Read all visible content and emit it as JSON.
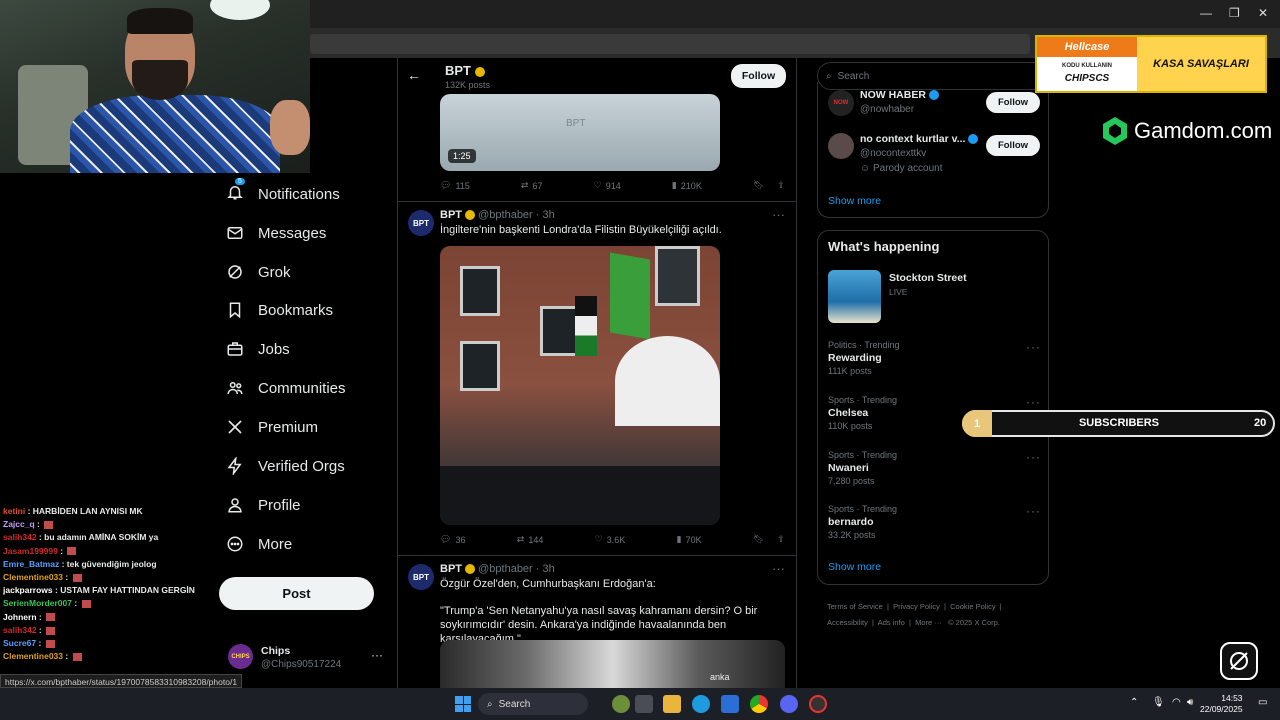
{
  "profile_header": {
    "name": "BPT",
    "posts": "132K posts",
    "follow_label": "Follow"
  },
  "tweets": [
    {
      "video_duration": "1:25",
      "video_watermark": "BPT",
      "replies": "115",
      "retweets": "67",
      "likes": "914",
      "views": "210K"
    },
    {
      "name": "BPT",
      "handle": "@bpthaber",
      "time": "· 3h",
      "text": "İngiltere'nin başkenti Londra'da Filistin Büyükelçiliği açıldı.",
      "replies": "36",
      "retweets": "144",
      "likes": "3.6K",
      "views": "70K"
    },
    {
      "name": "BPT",
      "handle": "@bpthaber",
      "time": "· 3h",
      "text_line1": "Özgür Özel'den, Cumhurbaşkanı Erdoğan'a:",
      "text_line2": "\"Trump'a 'Sen Netanyahu'ya nasıl savaş kahramanı dersin? O bir soykırımcıdır' desin. Ankara'ya indiğinde havaalanında ben karşılayacağım.\"",
      "media_tag": "anka"
    }
  ],
  "nav": {
    "notifications": "Notifications",
    "notifications_badge": "5",
    "messages": "Messages",
    "grok": "Grok",
    "bookmarks": "Bookmarks",
    "jobs": "Jobs",
    "communities": "Communities",
    "premium": "Premium",
    "verified_orgs": "Verified Orgs",
    "profile": "Profile",
    "more": "More",
    "post": "Post"
  },
  "account": {
    "name": "Chips",
    "handle": "@Chips90517224",
    "avatar_text": "CHIPS"
  },
  "search": {
    "placeholder": "Search"
  },
  "who_to_follow": {
    "items": [
      {
        "name": "NOW HABER",
        "handle": "@nowhaber",
        "follow": "Follow"
      },
      {
        "name": "no context kurtlar v...",
        "handle": "@nocontexttkv",
        "note": "Parody account",
        "follow": "Follow"
      }
    ],
    "show_more": "Show more"
  },
  "happening": {
    "title": "What's happening",
    "live": {
      "name": "Stockton Street",
      "status": "LIVE"
    },
    "trends": [
      {
        "context": "Politics · Trending",
        "topic": "Rewarding",
        "posts": "111K posts"
      },
      {
        "context": "Sports · Trending",
        "topic": "Chelsea",
        "posts": "110K posts"
      },
      {
        "context": "Sports · Trending",
        "topic": "Nwaneri",
        "posts": "7,280 posts"
      },
      {
        "context": "Sports · Trending",
        "topic": "bernardo",
        "posts": "33.2K posts"
      }
    ],
    "show_more": "Show more"
  },
  "footer": {
    "terms": "Terms of Service",
    "privacy": "Privacy Policy",
    "cookie": "Cookie Policy",
    "accessibility": "Accessibility",
    "ads": "Ads info",
    "more": "More ···",
    "copyright": "© 2025 X Corp."
  },
  "chat": [
    {
      "user": "ketini",
      "color": "#e0502a",
      "msg": "HARBİDEN LAN AYNISI MK"
    },
    {
      "user": "Zajcc_q",
      "color": "#c59bff",
      "msg": ""
    },
    {
      "user": "salih342",
      "color": "#d02a2a",
      "msg": "bu adamın AMİNA SOKİM ya"
    },
    {
      "user": "Jasam199999",
      "color": "#d02a2a",
      "msg": ""
    },
    {
      "user": "Emre_Batmaz",
      "color": "#5aa0ff",
      "msg": "tek güvendiğim jeolog"
    },
    {
      "user": "Clementine033",
      "color": "#e0a020",
      "msg": ""
    },
    {
      "user": "jackparrows",
      "color": "#ffffff",
      "msg": "USTAM FAY HATTINDAN GERGİN"
    },
    {
      "user": "SerienMorder007",
      "color": "#3ec45a",
      "msg": ""
    },
    {
      "user": "Johnern",
      "color": "#ffffff",
      "msg": ""
    },
    {
      "user": "salih342",
      "color": "#d02a2a",
      "msg": ""
    },
    {
      "user": "Sucre67",
      "color": "#5aa0ff",
      "msg": ""
    },
    {
      "user": "Clementine033",
      "color": "#e0a020",
      "msg": ""
    }
  ],
  "overlay": {
    "hellcase_brand": "Hellcase",
    "hellcase_code1": "KODU KULLANIN",
    "hellcase_code2": "CHIPSCS",
    "hellcase_promo": "KASA SAVAŞLARI",
    "gamdom": "Gamdom.com",
    "sub_current": "1",
    "sub_label": "SUBSCRIBERS",
    "sub_goal": "20"
  },
  "status_url": "https://x.com/bpthaber/status/1970078583310983208/photo/1",
  "taskbar": {
    "search": "Search",
    "time": "14:53",
    "date": "22/09/2025"
  },
  "colors": {
    "accent": "#1d9bf0",
    "bg": "#000000",
    "gold": "#e6b800"
  }
}
